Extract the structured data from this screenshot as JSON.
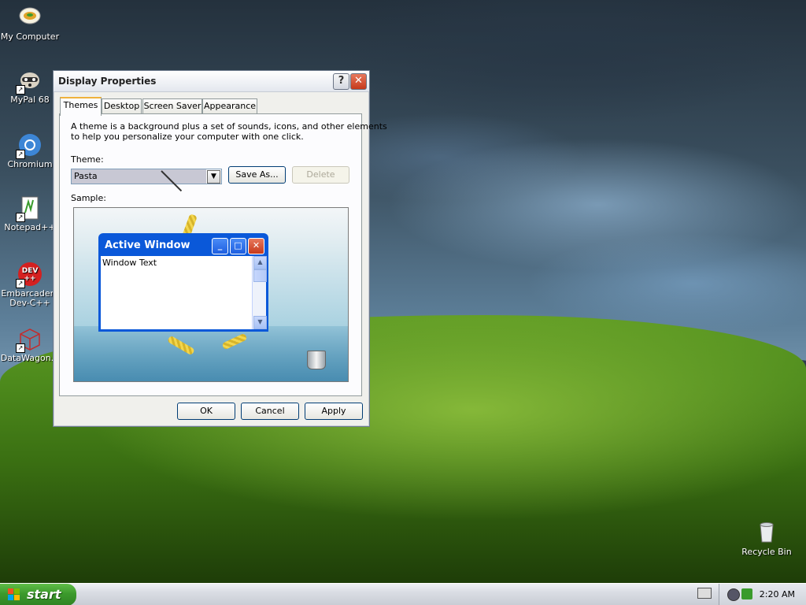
{
  "desktop": {
    "icons": [
      {
        "label": "My Computer"
      },
      {
        "label": "MyPal 68"
      },
      {
        "label": "Chromium"
      },
      {
        "label": "Notepad++"
      },
      {
        "label": "Embarcadero\nDev-C++",
        "line1": "Embarcadero",
        "line2": "Dev-C++"
      },
      {
        "label": "DataWagon..."
      },
      {
        "label": "Recycle Bin"
      }
    ],
    "dev_badge": "DEV\n++"
  },
  "dialog": {
    "title": "Display Properties",
    "help_symbol": "?",
    "close_symbol": "✕",
    "tabs": [
      {
        "label": "Themes",
        "active": true
      },
      {
        "label": "Desktop"
      },
      {
        "label": "Screen Saver"
      },
      {
        "label": "Appearance"
      }
    ],
    "description_line1": "A theme is a background plus a set of sounds, icons, and other elements",
    "description_line2": "to help you personalize your computer with one click.",
    "theme_label": "Theme:",
    "theme_value": "Pasta",
    "save_as_label": "Save As...",
    "delete_label": "Delete",
    "sample_label": "Sample:",
    "sample": {
      "active_window_title": "Active Window",
      "window_text": "Window Text"
    },
    "ok_label": "OK",
    "cancel_label": "Cancel",
    "apply_label": "Apply"
  },
  "taskbar": {
    "start_label": "start",
    "clock": "2:20 AM"
  }
}
